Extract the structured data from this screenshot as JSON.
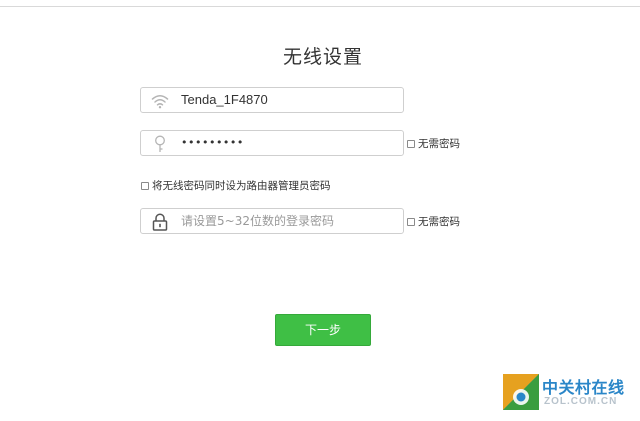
{
  "page": {
    "title": "无线设置"
  },
  "wifi_name": {
    "icon": "wifi-icon",
    "value": "Tenda_1F4870"
  },
  "wifi_password": {
    "icon": "key-icon",
    "value": "•••••••••",
    "no_password_label": "无需密码"
  },
  "same_as_admin": {
    "label": "将无线密码同时设为路由器管理员密码",
    "checked": false
  },
  "admin_password": {
    "icon": "lock-icon",
    "placeholder": "请设置5~32位数的登录密码",
    "no_password_label": "无需密码"
  },
  "actions": {
    "next_label": "下一步"
  },
  "colors": {
    "primary_button": "#3fbf45",
    "border": "#cfcfcf",
    "placeholder": "#999999"
  },
  "watermark": {
    "logo": "zol-logo",
    "cn": "中关村在线",
    "en": "ZOL.COM.CN"
  }
}
